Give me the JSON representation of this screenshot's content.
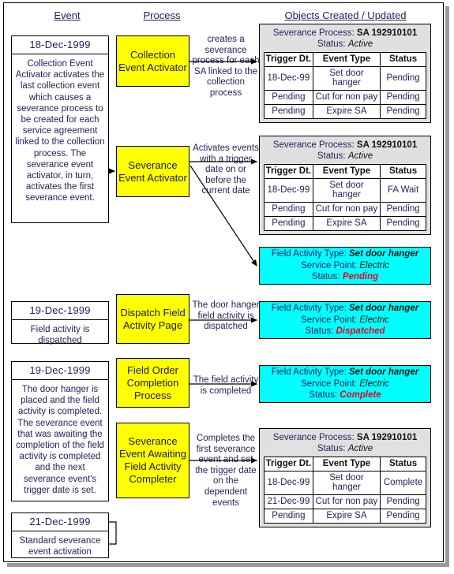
{
  "columns": {
    "event": "Event",
    "process": "Process",
    "objects": "Objects Created / Updated"
  },
  "events": [
    {
      "date": "18-Dec-1999",
      "text": "Collection Event Activator activates the last collection event which causes a severance process to be created for each service agreement linked to the collection process. The severance event activator, in turn, activates the first severance event."
    },
    {
      "date": "19-Dec-1999",
      "text": "Field activity is dispatched"
    },
    {
      "date": "19-Dec-1999",
      "text": "The door hanger is placed and the field activity is completed. The severance event that was awaiting the completion of the field activity is completed and the next severance event's trigger date is set."
    },
    {
      "date": "21-Dec-1999",
      "text": "Standard severance event activation"
    }
  ],
  "processes": [
    {
      "label": "Collection Event Activator"
    },
    {
      "label": "Severance Event Activator"
    },
    {
      "label": "Dispatch Field Activity Page"
    },
    {
      "label": "Field Order Completion Process"
    },
    {
      "label": "Severance Event Awaiting Field Activity Completer"
    }
  ],
  "captions": [
    "creates a severance process for each SA linked to the collection process",
    "Activates events with a trigger date on or before the current date",
    "The door hanger field activity is dispatched",
    "The field activity is completed",
    "Completes the first severance event and set the trigger date on the dependent events"
  ],
  "panels": [
    {
      "title_label": "Severance Process:",
      "title_value": "SA 192910101",
      "status_label": "Status:",
      "status_value": "Active",
      "headers": [
        "Trigger Dt.",
        "Event Type",
        "Status"
      ],
      "rows": [
        {
          "cells": [
            "18-Dec-99",
            "Set door hanger",
            "Pending"
          ],
          "red": [
            false,
            false,
            false
          ]
        },
        {
          "cells": [
            "Pending",
            "Cut for non pay",
            "Pending"
          ],
          "red": [
            false,
            false,
            false
          ]
        },
        {
          "cells": [
            "Pending",
            "Expire SA",
            "Pending"
          ],
          "red": [
            false,
            false,
            false
          ]
        }
      ]
    },
    {
      "title_label": "Severance Process:",
      "title_value": "SA 192910101",
      "status_label": "Status:",
      "status_value": "Active",
      "headers": [
        "Trigger Dt.",
        "Event Type",
        "Status"
      ],
      "rows": [
        {
          "cells": [
            "18-Dec-99",
            "Set door hanger",
            "FA Wait"
          ],
          "red": [
            false,
            false,
            true
          ]
        },
        {
          "cells": [
            "Pending",
            "Cut for non pay",
            "Pending"
          ],
          "red": [
            false,
            false,
            false
          ]
        },
        {
          "cells": [
            "Pending",
            "Expire SA",
            "Pending"
          ],
          "red": [
            false,
            false,
            false
          ]
        }
      ]
    },
    {
      "title_label": "Severance Process:",
      "title_value": "SA 192910101",
      "status_label": "Status:",
      "status_value": "Active",
      "headers": [
        "Trigger Dt.",
        "Event Type",
        "Status"
      ],
      "rows": [
        {
          "cells": [
            "18-Dec-99",
            "Set door hanger",
            "Complete"
          ],
          "red": [
            false,
            false,
            true
          ]
        },
        {
          "cells": [
            "21-Dec-99",
            "Cut for non pay",
            "Pending"
          ],
          "red": [
            true,
            false,
            false
          ]
        },
        {
          "cells": [
            "Pending",
            "Expire SA",
            "Pending"
          ],
          "red": [
            false,
            false,
            false
          ]
        }
      ]
    }
  ],
  "field_activities": [
    {
      "type_label": "Field Activity Type:",
      "type_value": "Set door hanger",
      "sp_label": "Service Point:",
      "sp_value": "Electric",
      "status_label": "Status:",
      "status_value": "Pending"
    },
    {
      "type_label": "Field Activity Type:",
      "type_value": "Set door hanger",
      "sp_label": "Service Point:",
      "sp_value": "Electric",
      "status_label": "Status:",
      "status_value": "Dispatched"
    },
    {
      "type_label": "Field Activity Type:",
      "type_value": "Set door hanger",
      "sp_label": "Service Point:",
      "sp_value": "Electric",
      "status_label": "Status:",
      "status_value": "Complete"
    }
  ],
  "colors": {
    "process_box": "#ffff00",
    "panel_bg": "#e0e0e0",
    "field_activity_bg": "#00ffff",
    "highlight_text": "#ee0022",
    "body_text": "#2b1a5e"
  }
}
